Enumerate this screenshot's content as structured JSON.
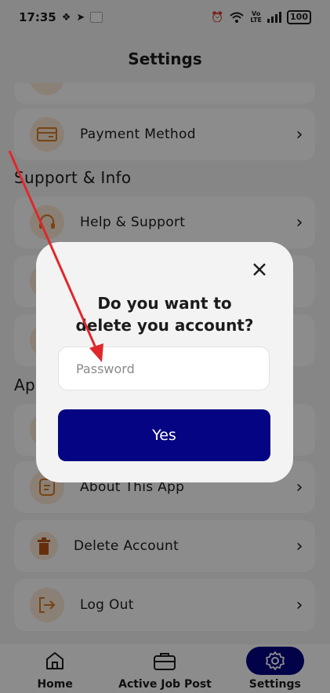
{
  "status_bar": {
    "time": "17:35",
    "battery": "100",
    "network_label": "Vo\nLTE"
  },
  "header": {
    "title": "Settings"
  },
  "sections": {
    "support_title": "Support & Info",
    "app_title_partial": "App"
  },
  "menu": {
    "payment": "Payment Method",
    "help": "Help & Support",
    "about": "About This App",
    "delete": "Delete Account",
    "logout": "Log Out"
  },
  "dialog": {
    "title": "Do you want to\ndelete you account?",
    "password_placeholder": "Password",
    "yes_label": "Yes"
  },
  "bottom_nav": [
    {
      "label": "Home",
      "icon": "home-icon"
    },
    {
      "label": "Active Job Post",
      "icon": "briefcase-icon"
    },
    {
      "label": "Settings",
      "icon": "gear-icon",
      "active": true
    }
  ],
  "colors": {
    "primary": "#050584",
    "accent": "#d97d29",
    "icon_bg": "#fbe9d6",
    "annotation": "#e0282c"
  }
}
